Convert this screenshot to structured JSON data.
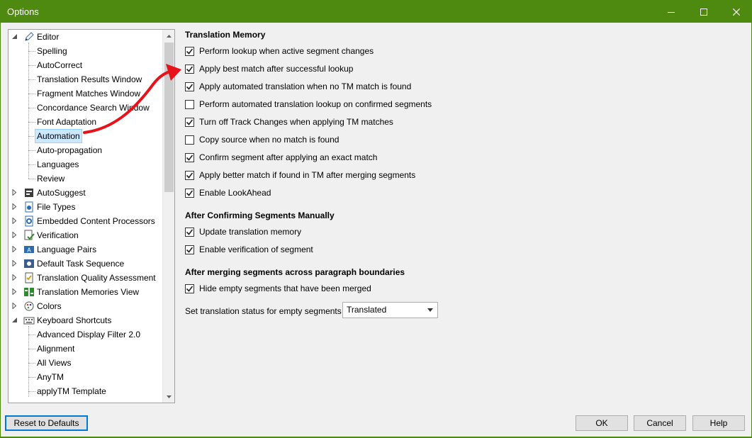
{
  "window": {
    "title": "Options"
  },
  "tree": {
    "items": [
      {
        "label": "Editor",
        "icon": "pencil-icon",
        "level": 0,
        "expanded": true
      },
      {
        "label": "Spelling",
        "level": 1
      },
      {
        "label": "AutoCorrect",
        "level": 1
      },
      {
        "label": "Translation Results Window",
        "level": 1
      },
      {
        "label": "Fragment Matches Window",
        "level": 1
      },
      {
        "label": "Concordance Search Window",
        "level": 1
      },
      {
        "label": "Font Adaptation",
        "level": 1
      },
      {
        "label": "Automation",
        "level": 1,
        "selected": true
      },
      {
        "label": "Auto-propagation",
        "level": 1
      },
      {
        "label": "Languages",
        "level": 1
      },
      {
        "label": "Review",
        "level": 1
      },
      {
        "label": "AutoSuggest",
        "icon": "autosuggest-icon",
        "level": 0,
        "expanded": false
      },
      {
        "label": "File Types",
        "icon": "file-types-icon",
        "level": 0,
        "expanded": false
      },
      {
        "label": "Embedded Content Processors",
        "icon": "embedded-content-icon",
        "level": 0,
        "expanded": false
      },
      {
        "label": "Verification",
        "icon": "verification-icon",
        "level": 0,
        "expanded": false
      },
      {
        "label": "Language Pairs",
        "icon": "language-pairs-icon",
        "level": 0,
        "expanded": false
      },
      {
        "label": "Default Task Sequence",
        "icon": "task-sequence-icon",
        "level": 0,
        "expanded": false
      },
      {
        "label": "Translation Quality Assessment",
        "icon": "tqa-icon",
        "level": 0,
        "expanded": false
      },
      {
        "label": "Translation Memories View",
        "icon": "tm-view-icon",
        "level": 0,
        "expanded": false
      },
      {
        "label": "Colors",
        "icon": "palette-icon",
        "level": 0,
        "expanded": false
      },
      {
        "label": "Keyboard Shortcuts",
        "icon": "keyboard-icon",
        "level": 0,
        "expanded": true
      },
      {
        "label": "Advanced Display Filter 2.0",
        "level": 1
      },
      {
        "label": "Alignment",
        "level": 1
      },
      {
        "label": "All Views",
        "level": 1
      },
      {
        "label": "AnyTM",
        "level": 1
      },
      {
        "label": "applyTM Template",
        "level": 1
      }
    ]
  },
  "translation_memory": {
    "title": "Translation Memory",
    "options": [
      {
        "label": "Perform lookup when active segment changes",
        "checked": true
      },
      {
        "label": "Apply best match after successful lookup",
        "checked": true
      },
      {
        "label": "Apply automated translation when no TM match is found",
        "checked": true
      },
      {
        "label": "Perform automated translation lookup on confirmed segments",
        "checked": false
      },
      {
        "label": "Turn off Track Changes when applying TM matches",
        "checked": true
      },
      {
        "label": "Copy source when no match is found",
        "checked": false
      },
      {
        "label": "Confirm segment after applying an exact match",
        "checked": true
      },
      {
        "label": "Apply better match if found in TM after merging segments",
        "checked": true
      },
      {
        "label": "Enable LookAhead",
        "checked": true
      }
    ]
  },
  "after_confirming": {
    "title": "After Confirming Segments Manually",
    "options": [
      {
        "label": "Update translation memory",
        "checked": true
      },
      {
        "label": "Enable verification of segment",
        "checked": true
      }
    ]
  },
  "after_merging": {
    "title": "After merging segments across paragraph boundaries",
    "options": [
      {
        "label": "Hide empty segments that have been merged",
        "checked": true
      }
    ],
    "status_label": "Set translation status for empty segments to:",
    "status_value": "Translated"
  },
  "buttons": {
    "reset": "Reset to Defaults",
    "ok": "OK",
    "cancel": "Cancel",
    "help": "Help"
  },
  "colors": {
    "titlebar": "#4f8a10",
    "selection": "#cce8ff",
    "annotation_arrow": "#e8121a"
  }
}
